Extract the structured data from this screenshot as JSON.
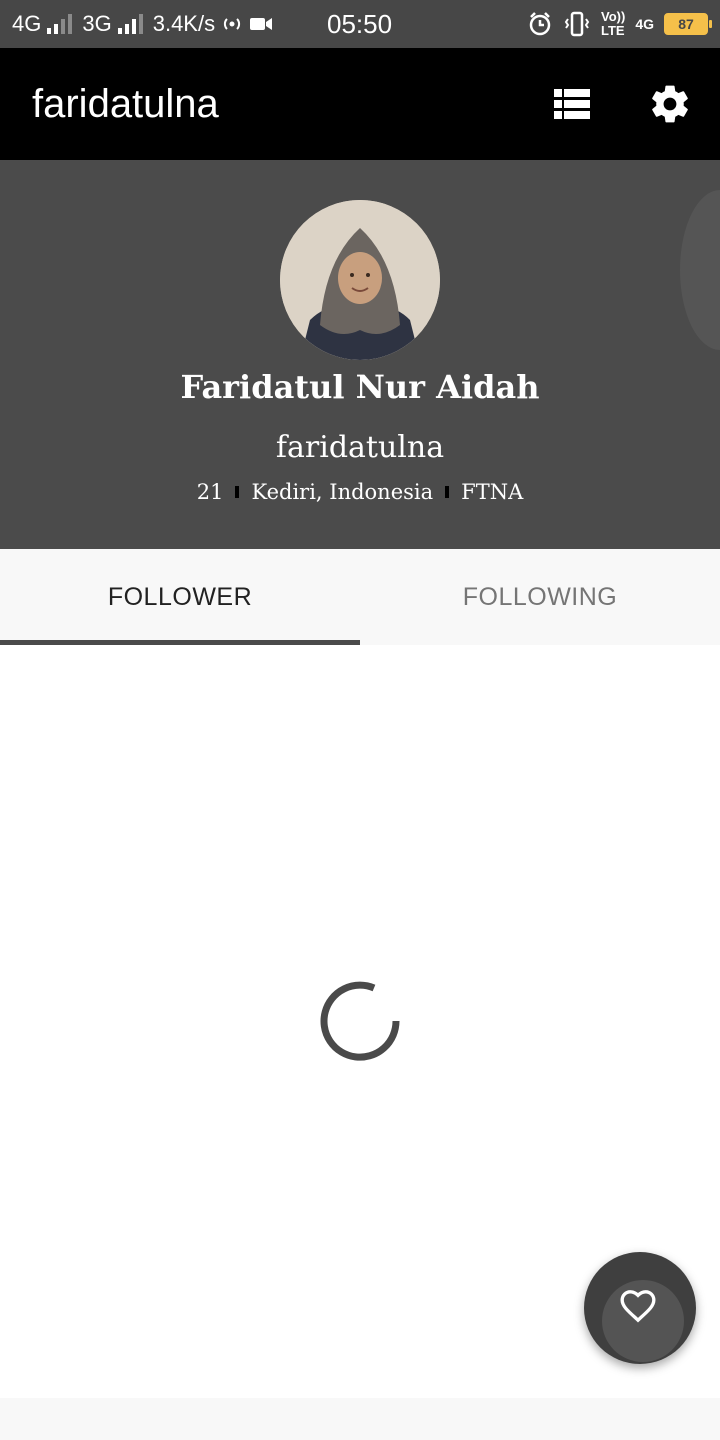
{
  "status_bar": {
    "network1": "4G",
    "network2": "3G",
    "speed": "3.4K/s",
    "time": "05:50",
    "volte_top": "Vo))",
    "volte_bottom": "LTE",
    "network3": "4G",
    "battery": "87",
    "battery_color": "#f5c04a"
  },
  "appbar": {
    "title": "faridatulna",
    "icons": [
      "list-icon",
      "gear-icon"
    ]
  },
  "profile": {
    "name": "Faridatul Nur Aidah",
    "username": "faridatulna",
    "age": "21",
    "location": "Kediri, Indonesia",
    "code": "FTNA"
  },
  "tabs": [
    {
      "label": "FOLLOWER",
      "active": true
    },
    {
      "label": "FOLLOWING",
      "active": false
    }
  ],
  "fab": {
    "icon": "heart-icon"
  }
}
